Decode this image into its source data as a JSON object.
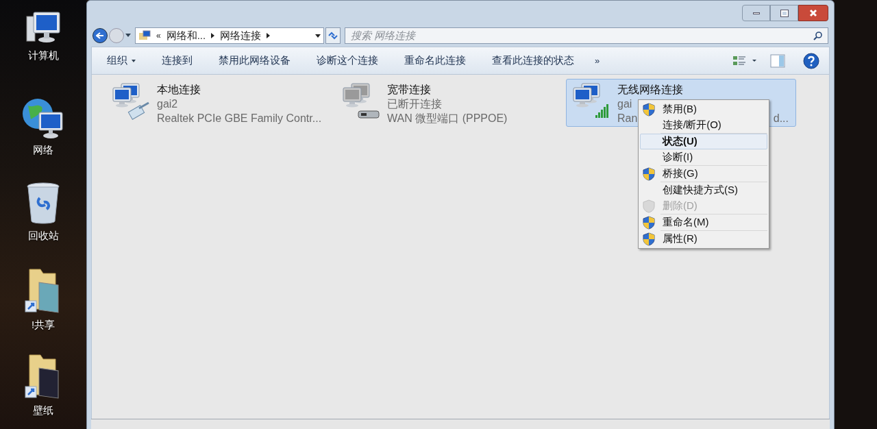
{
  "desktop_icons": [
    {
      "kind": "computer",
      "label": "计算机"
    },
    {
      "kind": "network",
      "label": "网络"
    },
    {
      "kind": "recycle",
      "label": "回收站"
    },
    {
      "kind": "shortcut-folder",
      "label": "!共享"
    },
    {
      "kind": "shortcut-folder",
      "label": "壁纸"
    }
  ],
  "address_bar": {
    "overflow": "«",
    "crumbs": [
      "网络和...",
      "网络连接"
    ],
    "search_placeholder": "搜索 网络连接"
  },
  "toolbar": {
    "items": [
      {
        "label": "组织",
        "dropdown": true
      },
      {
        "label": "连接到",
        "dropdown": false
      },
      {
        "label": "禁用此网络设备",
        "dropdown": false
      },
      {
        "label": "诊断这个连接",
        "dropdown": false
      },
      {
        "label": "重命名此连接",
        "dropdown": false
      },
      {
        "label": "查看此连接的状态",
        "dropdown": false
      }
    ],
    "more": "»"
  },
  "connections": [
    {
      "kind": "ethernet",
      "name": "本地连接",
      "status": "gai2",
      "device": "Realtek PCIe GBE Family Contr...",
      "selected": false
    },
    {
      "kind": "broadband",
      "name": "宽带连接",
      "status": "已断开连接",
      "device": "WAN 微型端口 (PPPOE)",
      "selected": false
    },
    {
      "kind": "wireless",
      "name": "无线网络连接",
      "status": "gai",
      "device": "Ran",
      "device_tail": "d...",
      "selected": true
    }
  ],
  "context_menu": {
    "groups": [
      [
        {
          "label": "禁用(B)",
          "kind": "shield",
          "default": false,
          "disabled": false,
          "selected": false
        },
        {
          "label": "连接/断开(O)",
          "kind": "plain",
          "default": false,
          "disabled": false,
          "selected": false
        }
      ],
      [
        {
          "label": "状态(U)",
          "kind": "plain",
          "default": true,
          "disabled": false,
          "selected": true
        },
        {
          "label": "诊断(I)",
          "kind": "plain",
          "default": false,
          "disabled": false,
          "selected": false
        }
      ],
      [
        {
          "label": "桥接(G)",
          "kind": "shield",
          "default": false,
          "disabled": false,
          "selected": false
        }
      ],
      [
        {
          "label": "创建快捷方式(S)",
          "kind": "plain",
          "default": false,
          "disabled": false,
          "selected": false
        },
        {
          "label": "删除(D)",
          "kind": "shield",
          "default": false,
          "disabled": true,
          "selected": false
        }
      ],
      [
        {
          "label": "重命名(M)",
          "kind": "shield",
          "default": false,
          "disabled": false,
          "selected": false
        }
      ],
      [
        {
          "label": "属性(R)",
          "kind": "shield",
          "default": false,
          "disabled": false,
          "selected": false
        }
      ]
    ]
  }
}
